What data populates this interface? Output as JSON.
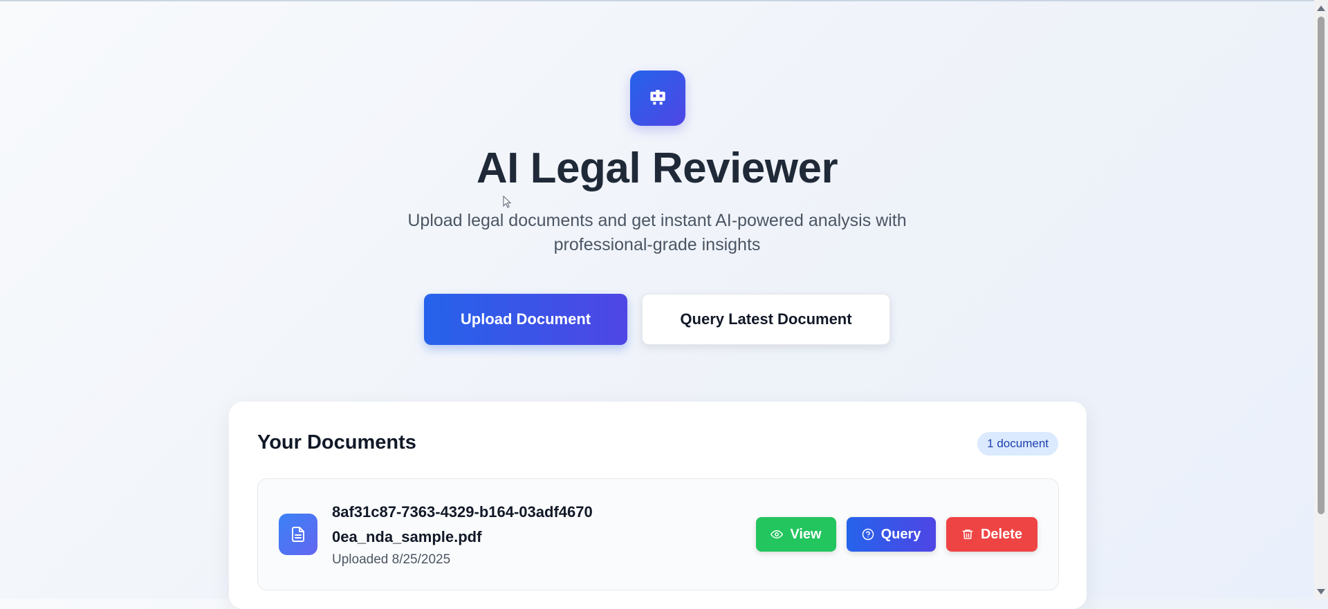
{
  "app": {
    "title": "AI Legal Reviewer",
    "subtitle": "Upload legal documents and get instant AI-powered analysis with professional-grade insights",
    "logo_icon": "robot-icon"
  },
  "actions": {
    "upload_label": "Upload Document",
    "query_latest_label": "Query Latest Document"
  },
  "documents": {
    "heading": "Your Documents",
    "count_label": "1 document",
    "items": [
      {
        "name": "8af31c87-7363-4329-b164-03adf46700ea_nda_sample.pdf",
        "uploaded": "Uploaded 8/25/2025",
        "icon": "file-icon",
        "view_label": "View",
        "query_label": "Query",
        "delete_label": "Delete"
      }
    ]
  },
  "colors": {
    "primary": "#2563eb",
    "accent": "#4f46e5",
    "view": "#22c55e",
    "delete": "#ef4444",
    "badge_bg": "#dbeafe"
  }
}
